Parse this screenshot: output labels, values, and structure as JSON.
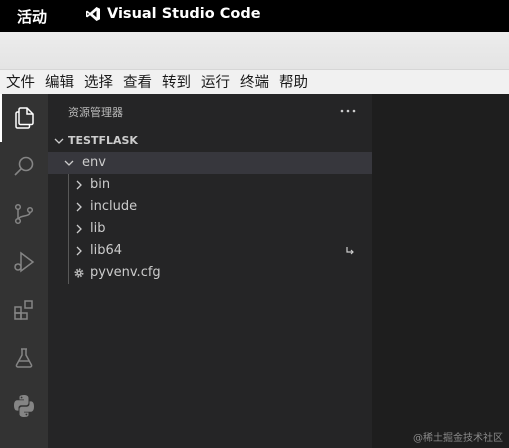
{
  "topbar": {
    "activities": "活动",
    "app_name": "Visual Studio Code",
    "app_icon": "vscode-icon"
  },
  "menubar": {
    "items": [
      "文件",
      "编辑",
      "选择",
      "查看",
      "转到",
      "运行",
      "终端",
      "帮助"
    ]
  },
  "activitybar": {
    "items": [
      {
        "icon": "explorer-icon",
        "active": true
      },
      {
        "icon": "search-icon"
      },
      {
        "icon": "source-control-icon"
      },
      {
        "icon": "run-debug-icon"
      },
      {
        "icon": "extensions-icon"
      },
      {
        "icon": "testing-icon"
      },
      {
        "icon": "python-icon"
      }
    ]
  },
  "sidebar": {
    "title": "资源管理器",
    "more_icon": "ellipsis-icon",
    "section_title": "TESTFLASK",
    "tree": [
      {
        "label": "env",
        "type": "folder",
        "expanded": true,
        "depth": 0,
        "selected": true
      },
      {
        "label": "bin",
        "type": "folder",
        "expanded": false,
        "depth": 1
      },
      {
        "label": "include",
        "type": "folder",
        "expanded": false,
        "depth": 1
      },
      {
        "label": "lib",
        "type": "folder",
        "expanded": false,
        "depth": 1
      },
      {
        "label": "lib64",
        "type": "folder",
        "expanded": false,
        "depth": 1,
        "symlink": true
      },
      {
        "label": "pyvenv.cfg",
        "type": "file",
        "icon": "gear-icon",
        "depth": 1
      }
    ]
  },
  "editor": {
    "watermark": "@稀土掘金技术社区"
  },
  "colors": {
    "activitybar_bg": "#333333",
    "sidebar_bg": "#252526",
    "editor_bg": "#1e1e1e",
    "selected_row": "#37373d"
  }
}
